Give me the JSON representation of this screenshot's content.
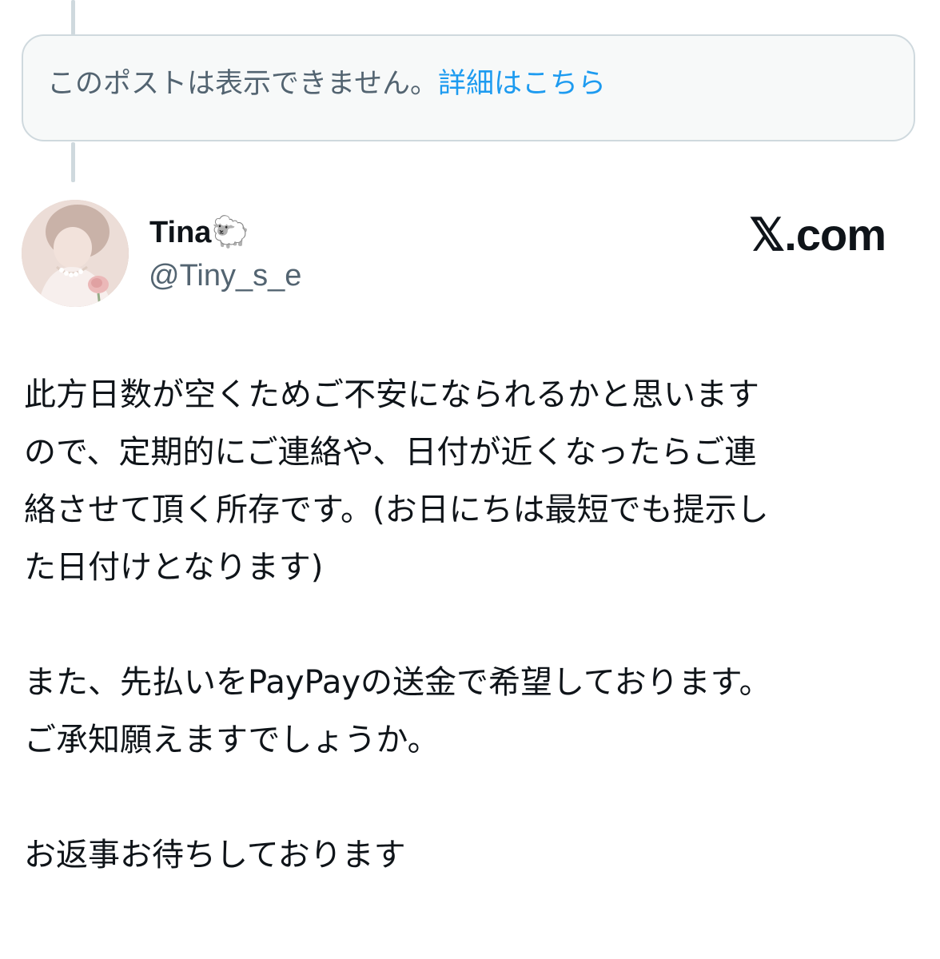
{
  "notice": {
    "text": "このポストは表示できません。",
    "link": "詳細はこちら"
  },
  "author": {
    "display_name": "Tina",
    "emoji": "🐑",
    "handle": "@Tiny_s_e"
  },
  "brand": {
    "label": "𝕏.com"
  },
  "post": {
    "paragraph1": [
      "此方日数が空くためご不安になられるかと思います",
      "ので、定期的にご連絡や、日付が近くなったらご連",
      "絡させて頂く所存です。(お日にちは最短でも提示し",
      "た日付けとなります)"
    ],
    "paragraph2": [
      "また、先払いをPayPayの送金で希望しております。",
      "ご承知願えますでしょうか。"
    ],
    "paragraph3": [
      "お返事お待ちしております"
    ]
  },
  "colors": {
    "link": "#1d9bf0",
    "secondary_text": "#536471",
    "primary_text": "#0f1419",
    "border": "#cfd9de",
    "notice_bg": "#f7f9f9"
  }
}
